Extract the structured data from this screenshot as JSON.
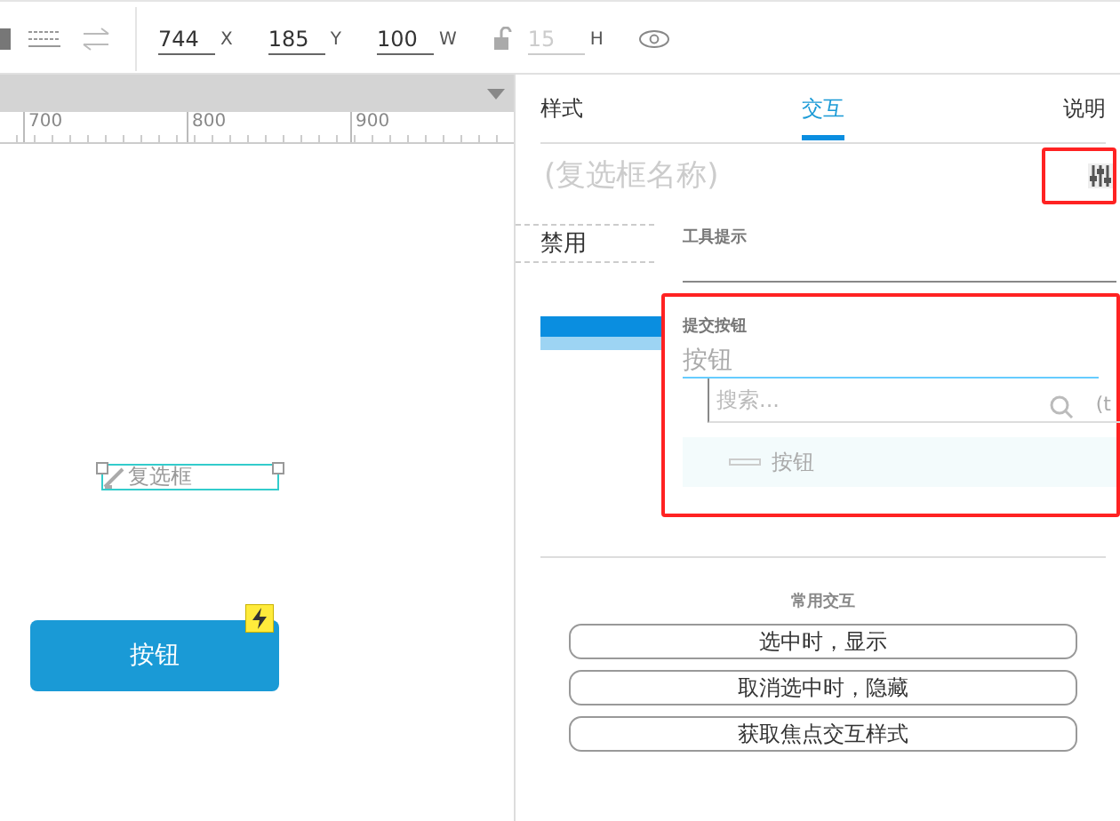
{
  "toolbar": {
    "fields": [
      {
        "value": "744",
        "label": "X",
        "disabled": false
      },
      {
        "value": "185",
        "label": "Y",
        "disabled": false
      },
      {
        "value": "100",
        "label": "W",
        "disabled": false
      },
      {
        "value": "15",
        "label": "H",
        "disabled": true
      }
    ]
  },
  "ruler": {
    "ticks": [
      "700",
      "800",
      "900"
    ]
  },
  "canvas": {
    "checkbox": {
      "label": "复选框"
    },
    "button": {
      "label": "按钮"
    }
  },
  "panel": {
    "tabs": [
      {
        "label": "样式",
        "selected": false
      },
      {
        "label": "交互",
        "selected": true
      },
      {
        "label": "说明",
        "selected": false
      }
    ],
    "name_field": {
      "placeholder": "(复选框名称)"
    },
    "disabled_menu": {
      "label": "禁用"
    },
    "tooltip": {
      "label": "工具提示"
    },
    "submit": {
      "label": "提交按钮",
      "value": "按钮",
      "search_placeholder": "搜索...",
      "hint": "(t",
      "options": [
        {
          "label": "按钮",
          "selected": true
        }
      ]
    },
    "common": {
      "title": "常用交互",
      "buttons": [
        "选中时，显示",
        "取消选中时，隐藏",
        "获取焦点交互样式"
      ]
    }
  }
}
